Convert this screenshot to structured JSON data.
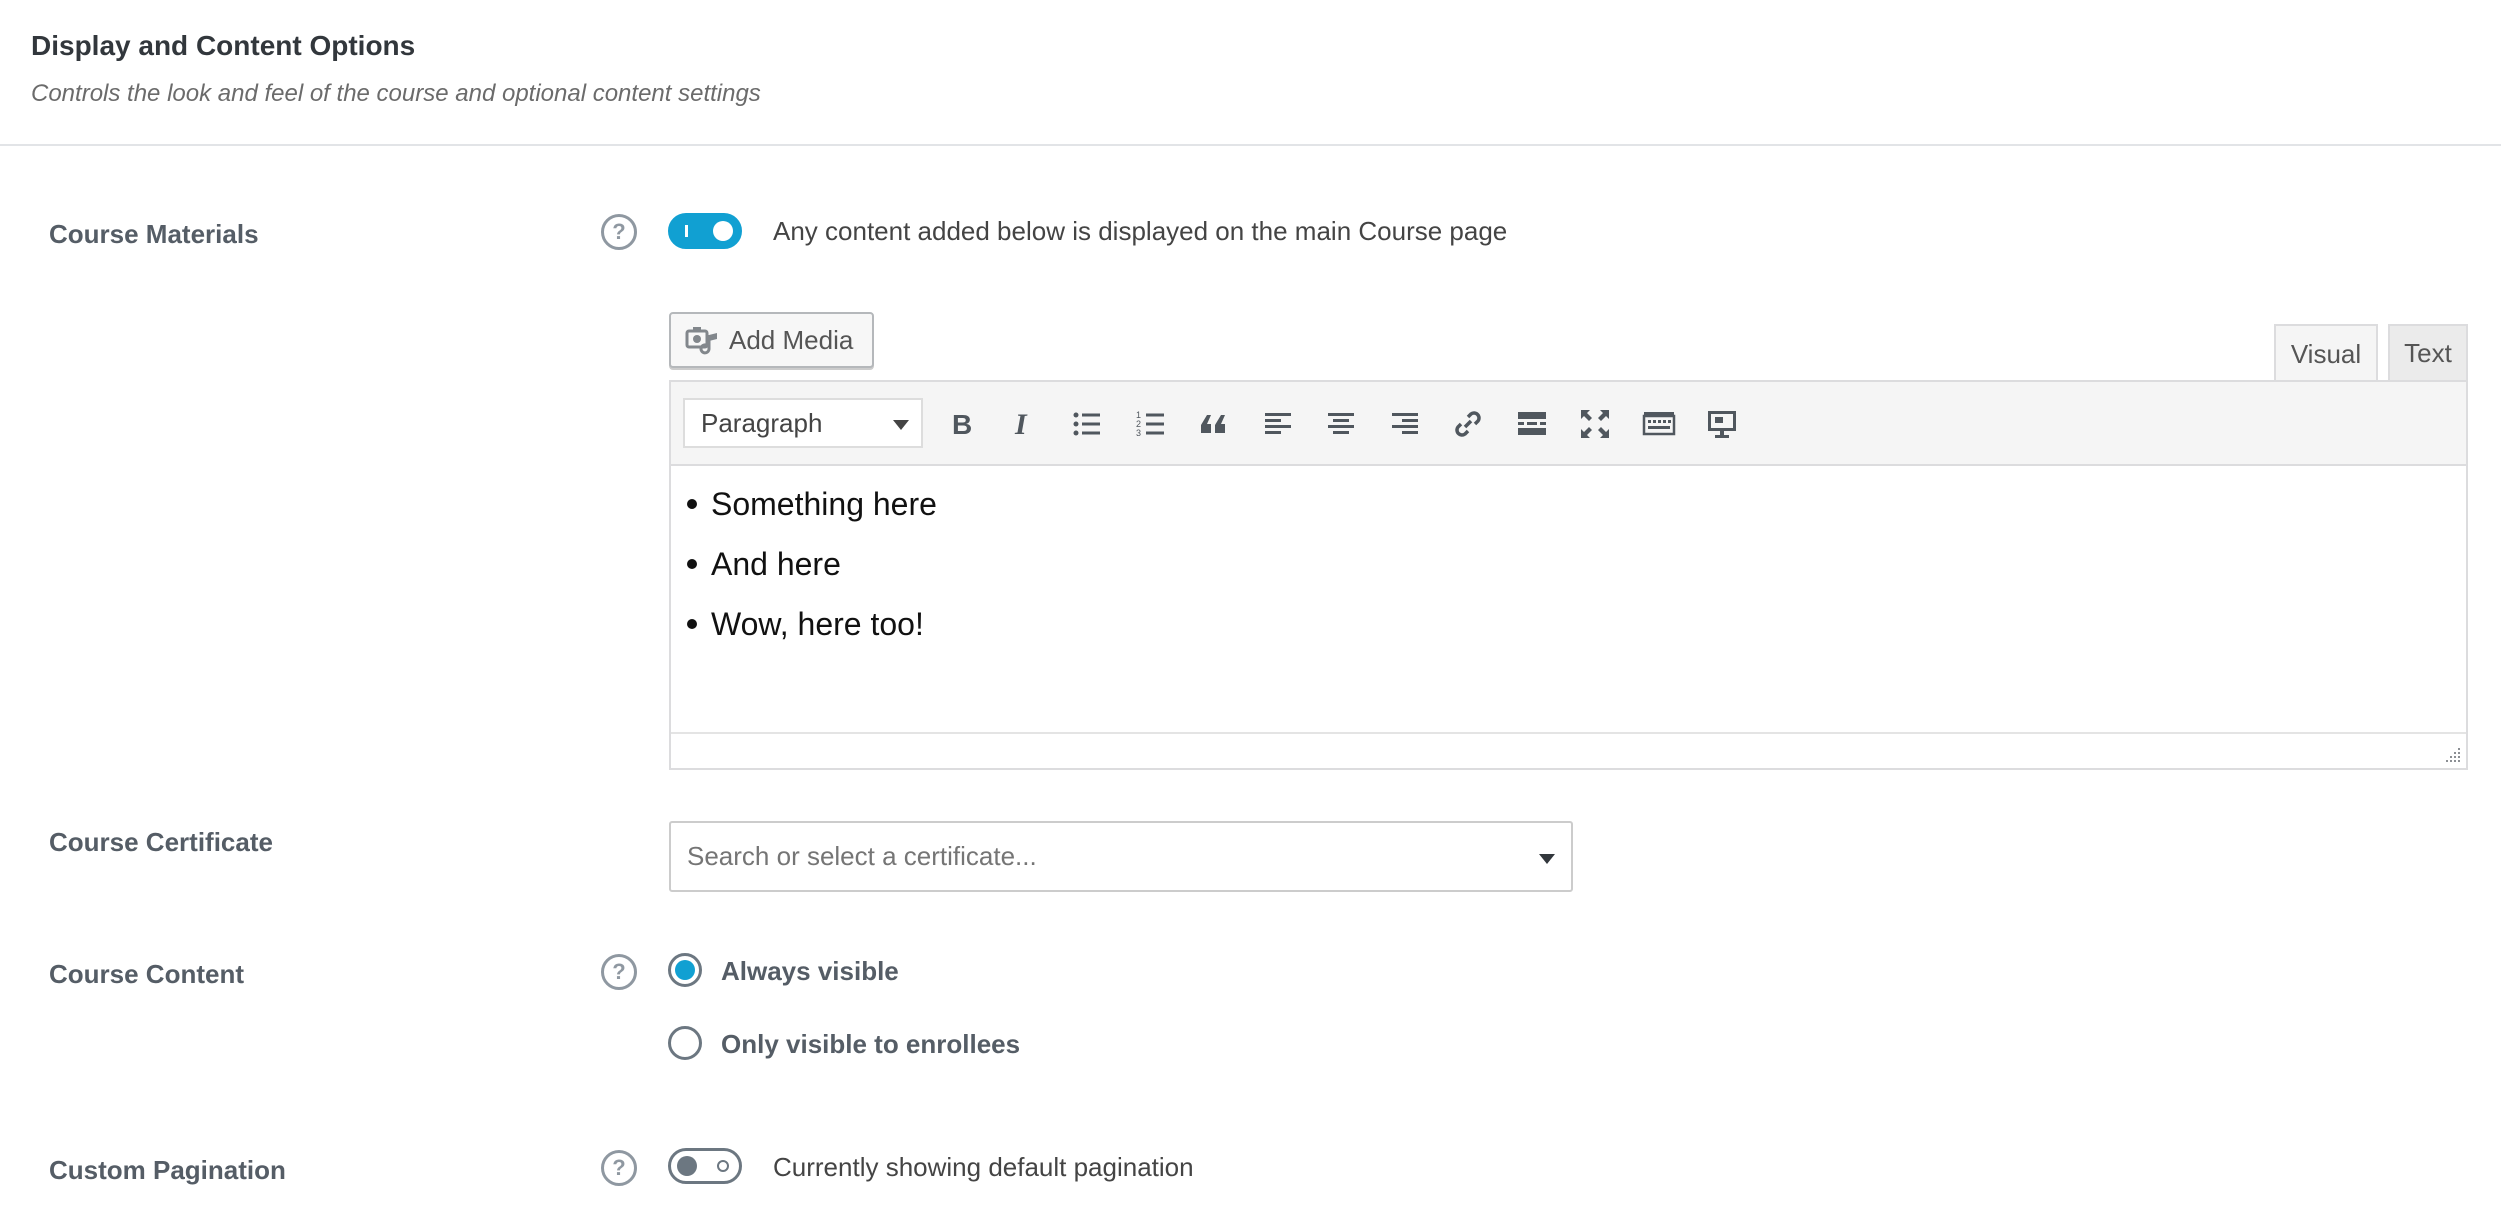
{
  "section": {
    "title": "Display and Content Options",
    "description": "Controls the look and feel of the course and optional content settings"
  },
  "course_materials": {
    "label": "Course Materials",
    "help_label": "?",
    "toggle_on": true,
    "toggle_text": "Any content added below is displayed on the main Course page"
  },
  "editor": {
    "add_media_label": "Add Media",
    "tabs": {
      "visual": "Visual",
      "text": "Text"
    },
    "active_tab": "Visual",
    "format_value": "Paragraph",
    "toolbar_icons": [
      "bold-icon",
      "italic-icon",
      "bulleted-list-icon",
      "numbered-list-icon",
      "blockquote-icon",
      "align-left-icon",
      "align-center-icon",
      "align-right-icon",
      "link-icon",
      "read-more-icon",
      "fullscreen-icon",
      "toolbar-toggle-icon",
      "preview-icon"
    ],
    "content_items": [
      "Something here",
      "And here",
      "Wow, here too!"
    ]
  },
  "course_certificate": {
    "label": "Course Certificate",
    "placeholder": "Search or select a certificate..."
  },
  "course_content": {
    "label": "Course Content",
    "help_label": "?",
    "options": [
      "Always visible",
      "Only visible to enrollees"
    ],
    "selected": "Always visible"
  },
  "custom_pagination": {
    "label": "Custom Pagination",
    "help_label": "?",
    "toggle_on": false,
    "toggle_text": "Currently showing default pagination"
  },
  "colors": {
    "accent": "#11a0d2",
    "label": "#555d66"
  }
}
